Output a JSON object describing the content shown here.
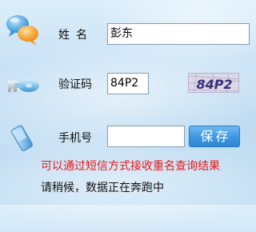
{
  "form": {
    "name_label": "姓名",
    "name_value": "彭东",
    "code_label": "验证码",
    "code_value": "84P2",
    "captcha_text": "84P2",
    "phone_label": "手机号",
    "phone_value": "",
    "save_label": "保存"
  },
  "messages": {
    "notice": "可以通过短信方式接收重名查询结果",
    "status": "请稍候，数据正在奔跑中"
  },
  "colors": {
    "notice_text": "#e8191b",
    "button_blue": "#3d97e2"
  },
  "icons": {
    "name_row": "chat-bubbles-icon",
    "code_row": "key-icon",
    "phone_row": "mobile-phone-icon"
  }
}
